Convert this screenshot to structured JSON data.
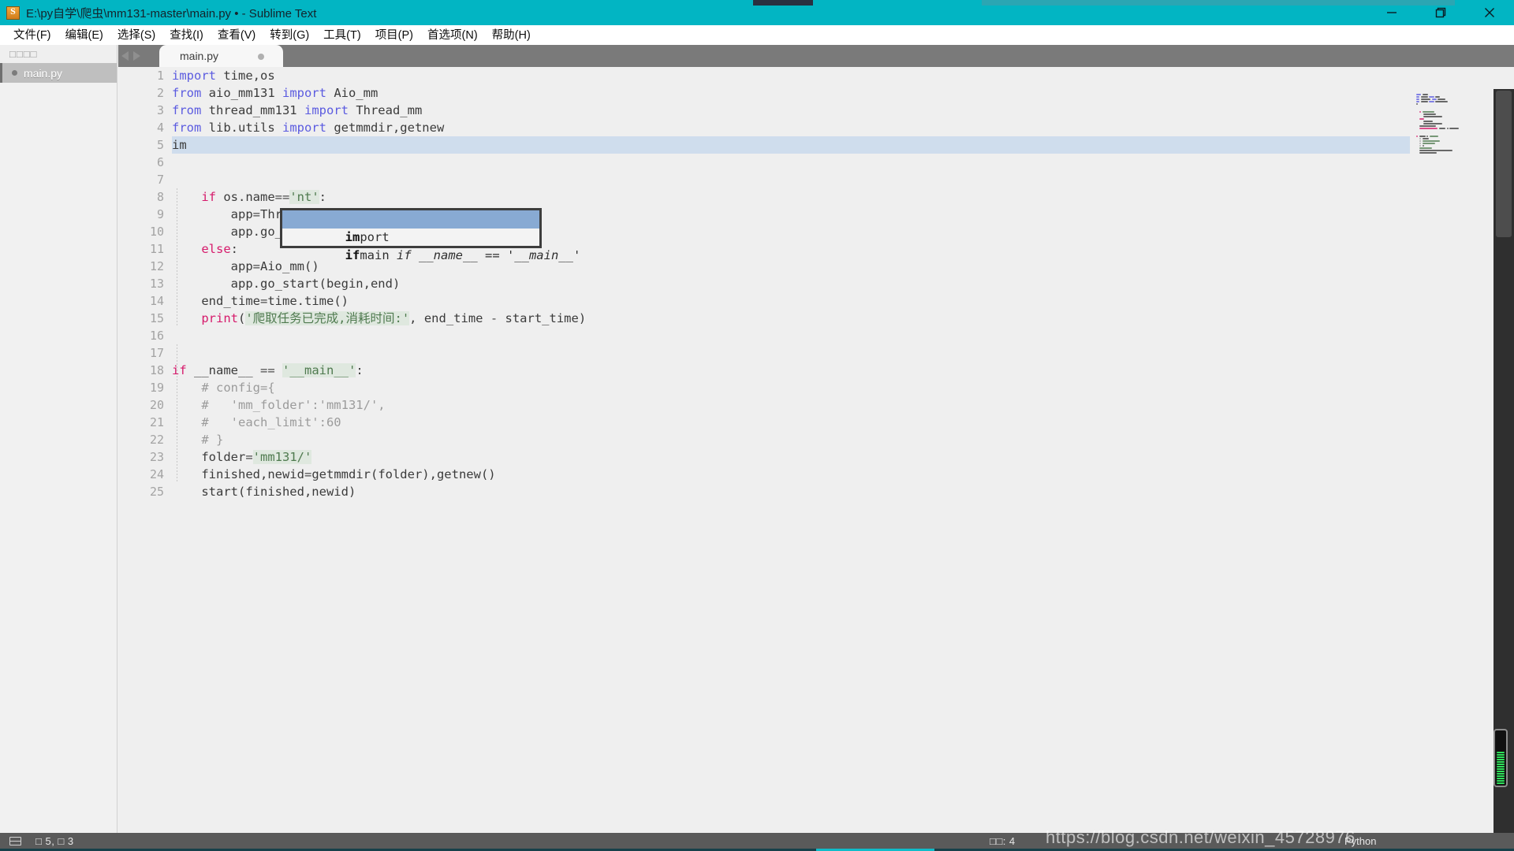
{
  "window": {
    "title": "E:\\py自学\\爬虫\\mm131-master\\main.py • - Sublime Text",
    "app_icon": "sublime-text-icon",
    "titlebar_color": "#02b5c3",
    "controls": {
      "minimize": "minimize-icon",
      "maximize": "restore-icon",
      "close": "close-icon"
    }
  },
  "menubar": {
    "items": [
      {
        "label": "文件(F)"
      },
      {
        "label": "编辑(E)"
      },
      {
        "label": "选择(S)"
      },
      {
        "label": "查找(I)"
      },
      {
        "label": "查看(V)"
      },
      {
        "label": "转到(G)"
      },
      {
        "label": "工具(T)"
      },
      {
        "label": "项目(P)"
      },
      {
        "label": "首选项(N)"
      },
      {
        "label": "帮助(H)"
      }
    ]
  },
  "sidebar": {
    "header": "□□□□",
    "open_file": "main.py"
  },
  "tabbar": {
    "nav_left": "nav-left-arrow-icon",
    "nav_right": "nav-right-arrow-icon",
    "tab_label": "main.py",
    "dirty": true
  },
  "editor": {
    "active_line": 5,
    "line_numbers": [
      1,
      2,
      3,
      4,
      5,
      6,
      7,
      8,
      9,
      10,
      11,
      12,
      13,
      14,
      15,
      16,
      17,
      18,
      19,
      20,
      21,
      22,
      23,
      24,
      25
    ],
    "lines": [
      {
        "n": 1,
        "text": "import time,os"
      },
      {
        "n": 2,
        "text": "from aio_mm131 import Aio_mm"
      },
      {
        "n": 3,
        "text": "from thread_mm131 import Thread_mm"
      },
      {
        "n": 4,
        "text": "from lib.utils import getmmdir,getnew"
      },
      {
        "n": 5,
        "text": "im"
      },
      {
        "n": 6,
        "text": ""
      },
      {
        "n": 7,
        "text": ""
      },
      {
        "n": 8,
        "text": "    if os.name=='nt':"
      },
      {
        "n": 9,
        "text": "        app=Thread_mm()"
      },
      {
        "n": 10,
        "text": "        app.go_start(begin,end)"
      },
      {
        "n": 11,
        "text": "    else:"
      },
      {
        "n": 12,
        "text": "        app=Aio_mm()"
      },
      {
        "n": 13,
        "text": "        app.go_start(begin,end)"
      },
      {
        "n": 14,
        "text": "    end_time=time.time()"
      },
      {
        "n": 15,
        "text": "    print('爬取任务已完成,消耗时间:', end_time - start_time)"
      },
      {
        "n": 16,
        "text": ""
      },
      {
        "n": 17,
        "text": ""
      },
      {
        "n": 18,
        "text": "if __name__ == '__main__':"
      },
      {
        "n": 19,
        "text": "    # config={"
      },
      {
        "n": 20,
        "text": "    #   'mm_folder':'mm131/',"
      },
      {
        "n": 21,
        "text": "    #   'each_limit':60"
      },
      {
        "n": 22,
        "text": "    # }"
      },
      {
        "n": 23,
        "text": "    folder='mm131/'"
      },
      {
        "n": 24,
        "text": "    finished,newid=getmmdir(folder),getnew()"
      },
      {
        "n": 25,
        "text": "    start(finished,newid)"
      }
    ],
    "colors": {
      "keyword": "#5b5be0",
      "control": "#d61a6b",
      "string": "#4f7a4f",
      "string_bg": "#dfe8df",
      "comment": "#9b9b9b",
      "text": "#3b3b3b",
      "background": "#efefef",
      "active_line": "#cfdded"
    }
  },
  "autocomplete": {
    "visible": true,
    "items": [
      {
        "match": "im",
        "rest": "port",
        "hint": "",
        "selected": true
      },
      {
        "match": "if",
        "rest": "main",
        "hint": "if __name__ == '__main__'",
        "selected": false
      }
    ]
  },
  "statusbar": {
    "layout_icon": "layout-icon",
    "line_col": "□ 5, □ 3",
    "tab_size": "□□: 4",
    "syntax": "Python"
  },
  "watermark": "https://blog.csdn.net/weixin_45728976",
  "recorder": {
    "name": "screen-recorder-indicator",
    "bar_color": "#2ee05a",
    "bars": 14
  }
}
